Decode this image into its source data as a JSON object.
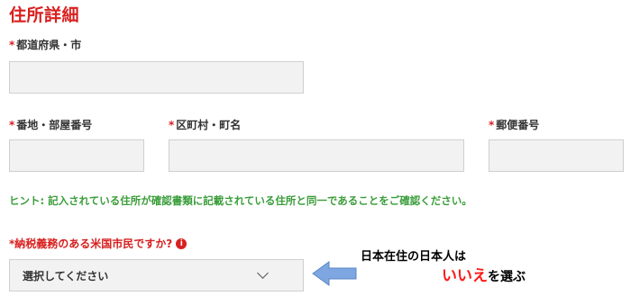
{
  "section": {
    "title": "住所詳細"
  },
  "fields": {
    "city": {
      "label": "都道府県・市",
      "required_mark": "*"
    },
    "street": {
      "label": "番地・部屋番号",
      "required_mark": "*"
    },
    "district": {
      "label": "区町村・町名",
      "required_mark": "*"
    },
    "postal": {
      "label": "郵便番号",
      "required_mark": "*"
    }
  },
  "hint": "ヒント: 記入されている住所が確認書類に記載されている住所と同一であることをご確認ください。",
  "tax_question": {
    "label": "*納税義務のある米国市民ですか?",
    "info_icon": "info-icon",
    "select_value": "選択してください"
  },
  "annotation": {
    "line1": "日本在住の日本人は",
    "emphasis": "いいえ",
    "line2_suffix": "を選ぶ",
    "arrow_color": "#7ea6e0"
  },
  "colors": {
    "accent_red": "#d8201f",
    "hint_green": "#3a9d3a",
    "field_bg": "#f2f2f2"
  }
}
